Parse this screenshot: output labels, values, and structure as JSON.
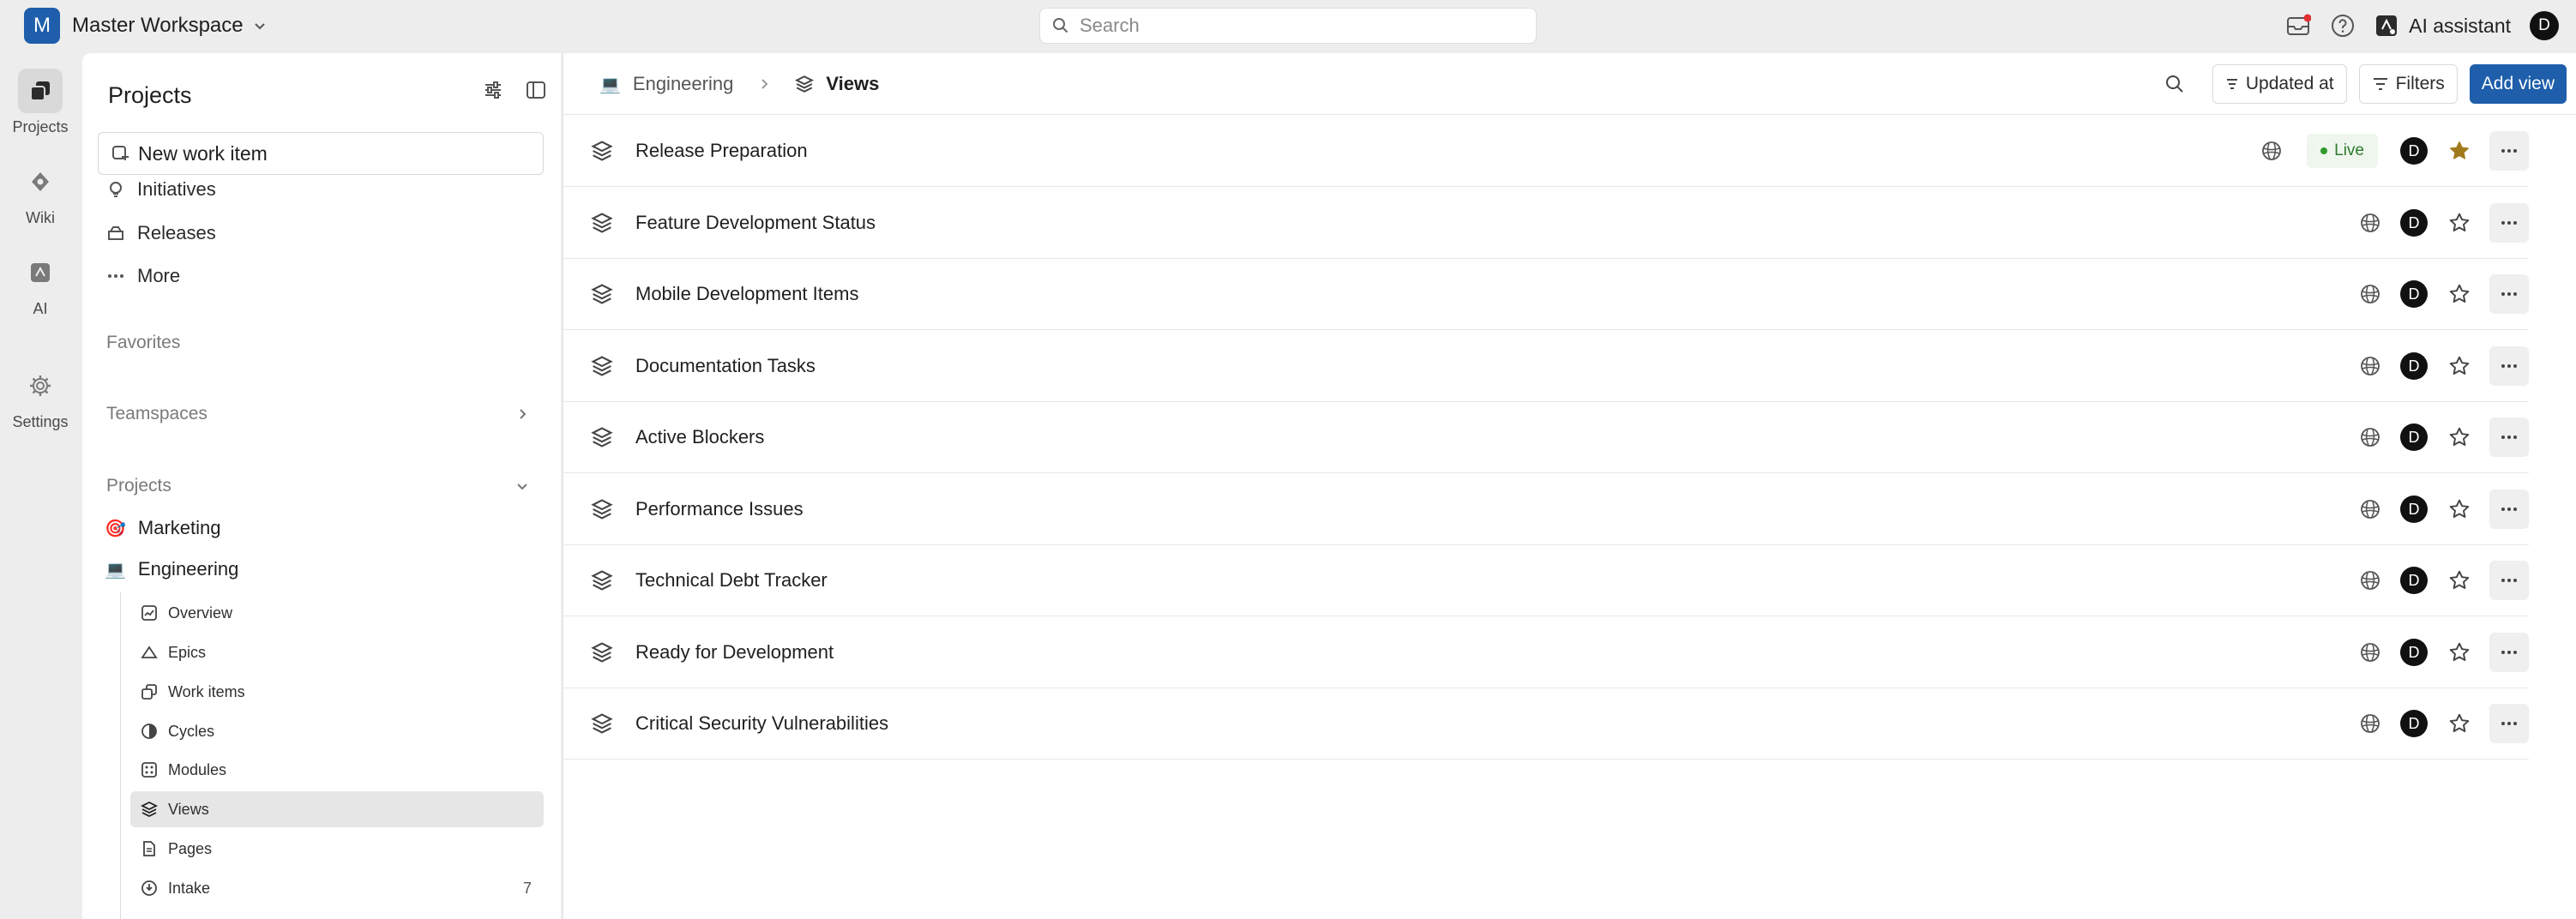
{
  "workspace": {
    "avatar_letter": "M",
    "name": "Master Workspace"
  },
  "search": {
    "placeholder": "Search"
  },
  "topbar": {
    "ai_label": "AI assistant",
    "user_initial": "D"
  },
  "rail": [
    {
      "label": "Projects",
      "icon": "projects-icon",
      "active": true
    },
    {
      "label": "Wiki",
      "icon": "wiki-icon"
    },
    {
      "label": "AI",
      "icon": "ai-icon"
    },
    {
      "label": "Settings",
      "icon": "gear-icon"
    }
  ],
  "sidebar": {
    "title": "Projects",
    "new_item": "New work item",
    "nav": [
      "Initiatives",
      "Releases",
      "More"
    ],
    "favorites": "Favorites",
    "teamspaces": "Teamspaces",
    "projects_section": "Projects",
    "projects": [
      {
        "name": "Marketing",
        "emoji": "🎯"
      },
      {
        "name": "Engineering",
        "emoji": "💻"
      }
    ],
    "sub_items": [
      {
        "label": "Overview"
      },
      {
        "label": "Epics"
      },
      {
        "label": "Work items"
      },
      {
        "label": "Cycles"
      },
      {
        "label": "Modules"
      },
      {
        "label": "Views",
        "active": true
      },
      {
        "label": "Pages"
      },
      {
        "label": "Intake",
        "count": "7"
      }
    ]
  },
  "breadcrumb": {
    "project": "Engineering",
    "current": "Views"
  },
  "header_actions": {
    "sort_label": "Updated at",
    "filters_label": "Filters",
    "add_label": "Add view"
  },
  "views": [
    {
      "name": "Release Preparation",
      "live_label": "Live",
      "owner": "D",
      "favorited": true
    },
    {
      "name": "Feature Development Status",
      "owner": "D"
    },
    {
      "name": "Mobile Development Items",
      "owner": "D"
    },
    {
      "name": "Documentation Tasks",
      "owner": "D"
    },
    {
      "name": "Active Blockers",
      "owner": "D"
    },
    {
      "name": "Performance Issues",
      "owner": "D"
    },
    {
      "name": "Technical Debt Tracker",
      "owner": "D"
    },
    {
      "name": "Ready for Development",
      "owner": "D"
    },
    {
      "name": "Critical Security Vulnerabilities",
      "owner": "D"
    }
  ],
  "colors": {
    "accent": "#1e5eab",
    "favorite": "#a07a1c",
    "live": "#2d7a2d"
  }
}
